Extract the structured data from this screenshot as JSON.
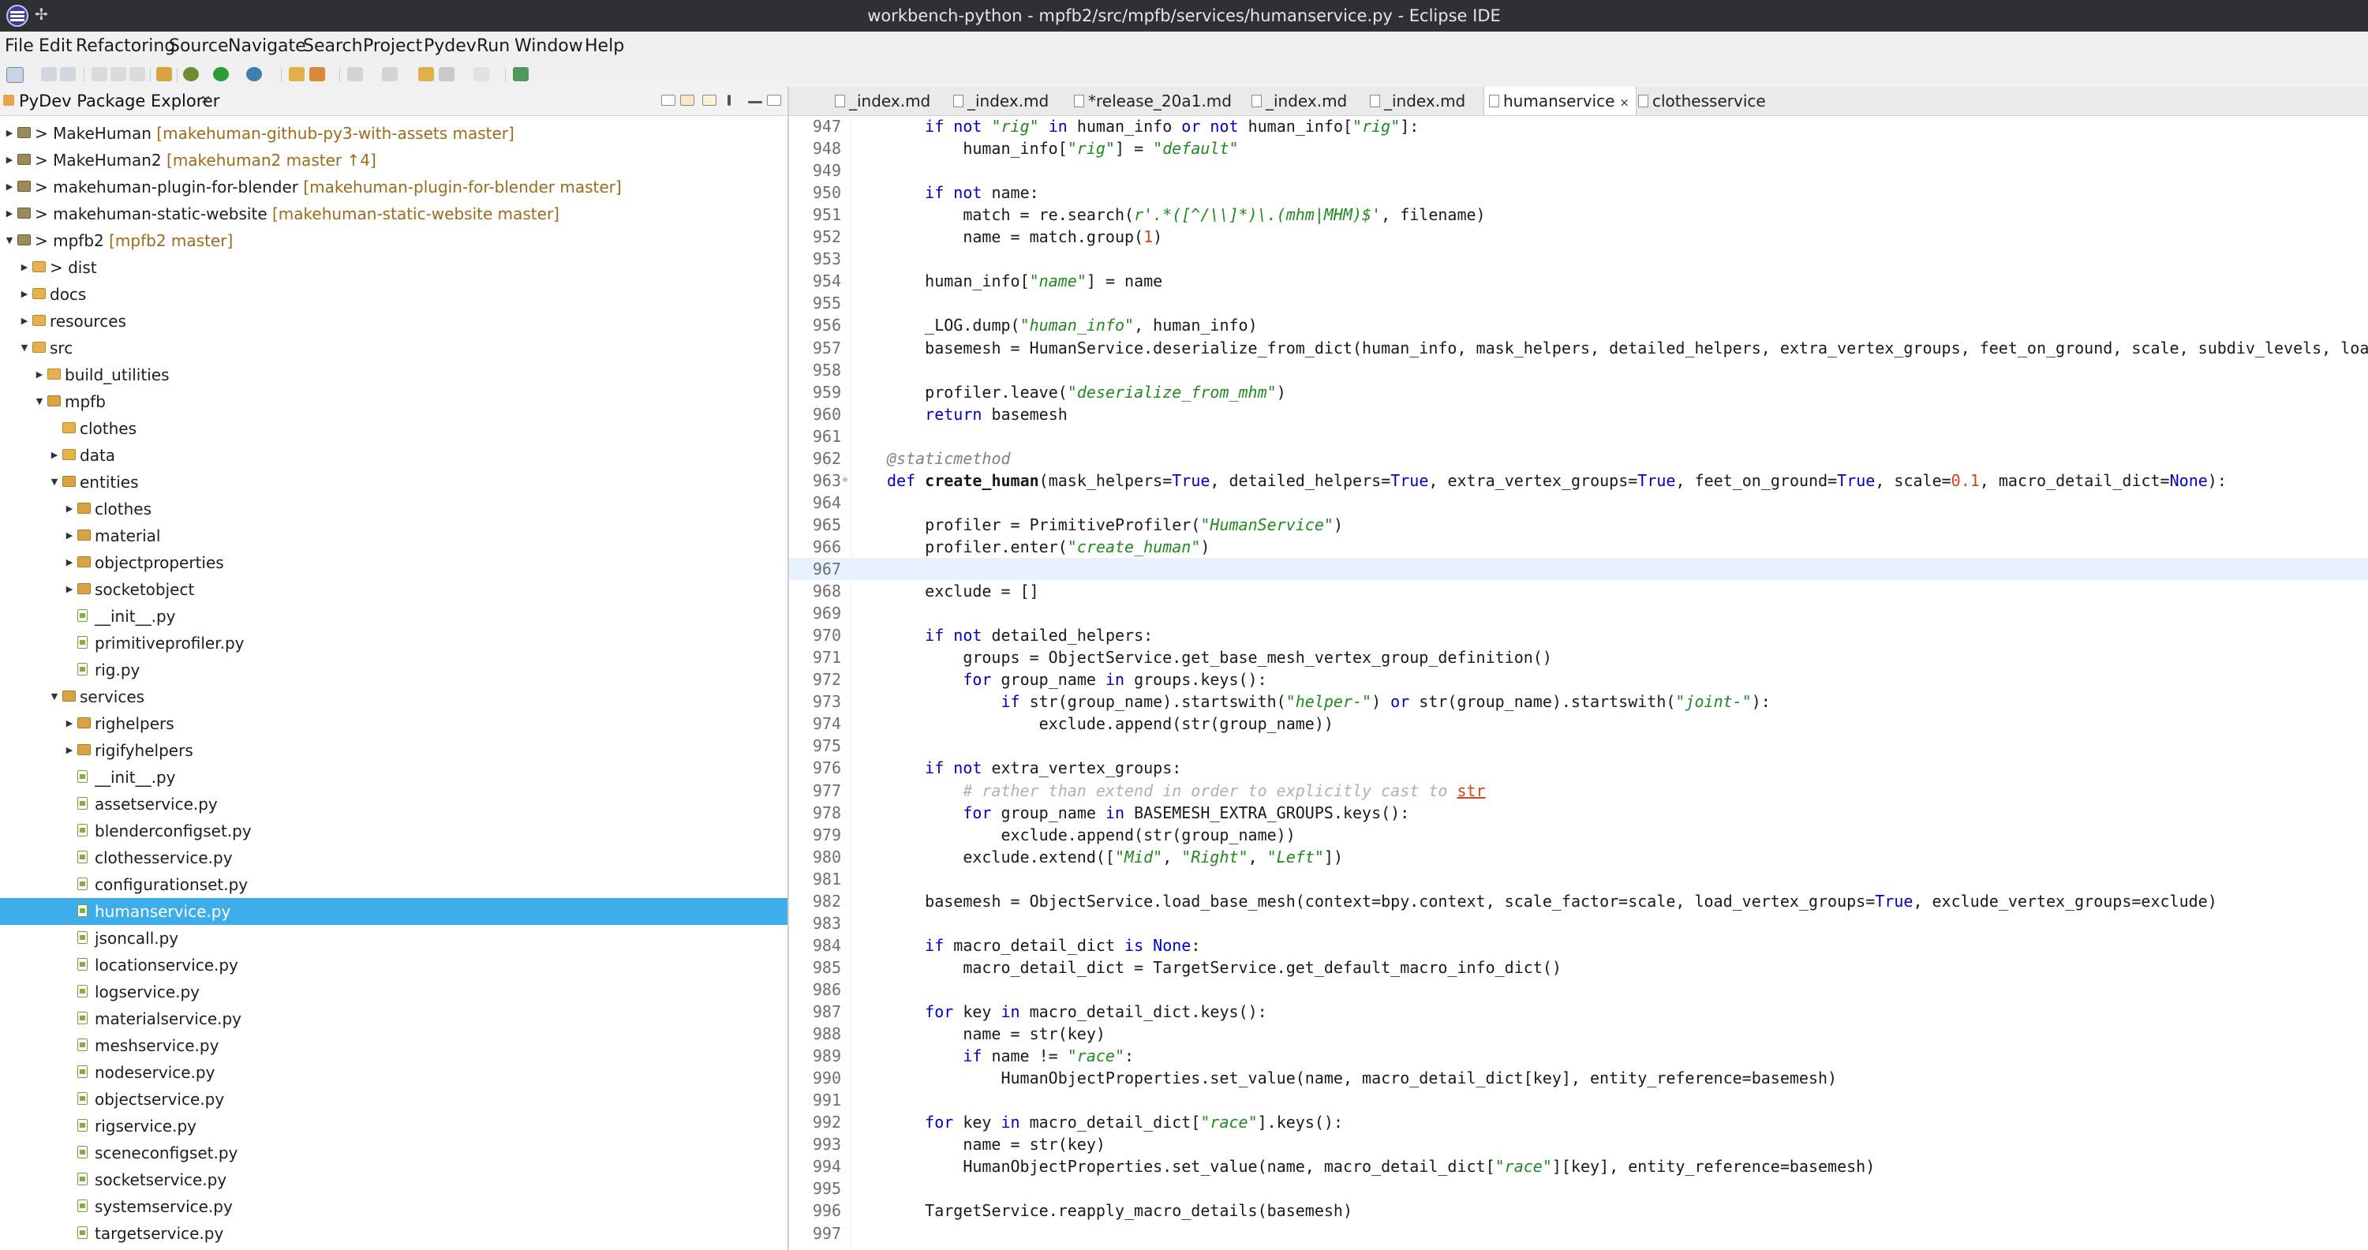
{
  "window": {
    "title": "workbench-python - mpfb2/src/mpfb/services/humanservice.py - Eclipse IDE"
  },
  "menu": [
    "File",
    "Edit",
    "Refactoring",
    "Source",
    "Navigate",
    "Search",
    "Project",
    "Pydev",
    "Run",
    "Window",
    "Help"
  ],
  "explorer": {
    "title": "PyDev Package Explorer",
    "close_symbol": "×",
    "rows": [
      {
        "label": "> MakeHuman",
        "git": "[makehuman-github-py3-with-assets master]",
        "depth": 0,
        "arrow": "right",
        "icon": "project"
      },
      {
        "label": "> MakeHuman2",
        "git": "[makehuman2 master ↑4]",
        "depth": 0,
        "arrow": "right",
        "icon": "project"
      },
      {
        "label": "> makehuman-plugin-for-blender",
        "git": "[makehuman-plugin-for-blender master]",
        "depth": 0,
        "arrow": "right",
        "icon": "project"
      },
      {
        "label": "> makehuman-static-website",
        "git": "[makehuman-static-website master]",
        "depth": 0,
        "arrow": "right",
        "icon": "project"
      },
      {
        "label": "> mpfb2",
        "git": "[mpfb2 master]",
        "depth": 0,
        "arrow": "down",
        "icon": "project"
      },
      {
        "label": "> dist",
        "git": "",
        "depth": 1,
        "arrow": "right",
        "icon": "folder"
      },
      {
        "label": "docs",
        "git": "",
        "depth": 1,
        "arrow": "right",
        "icon": "folder"
      },
      {
        "label": "resources",
        "git": "",
        "depth": 1,
        "arrow": "right",
        "icon": "folder"
      },
      {
        "label": "src",
        "git": "",
        "depth": 1,
        "arrow": "down",
        "icon": "folder"
      },
      {
        "label": "build_utilities",
        "git": "",
        "depth": 2,
        "arrow": "right",
        "icon": "folder"
      },
      {
        "label": "mpfb",
        "git": "",
        "depth": 2,
        "arrow": "down",
        "icon": "pkg"
      },
      {
        "label": "clothes",
        "git": "",
        "depth": 3,
        "arrow": "",
        "icon": "folder"
      },
      {
        "label": "data",
        "git": "",
        "depth": 3,
        "arrow": "right",
        "icon": "folder"
      },
      {
        "label": "entities",
        "git": "",
        "depth": 3,
        "arrow": "down",
        "icon": "pkg"
      },
      {
        "label": "clothes",
        "git": "",
        "depth": 4,
        "arrow": "right",
        "icon": "pkg"
      },
      {
        "label": "material",
        "git": "",
        "depth": 4,
        "arrow": "right",
        "icon": "pkg"
      },
      {
        "label": "objectproperties",
        "git": "",
        "depth": 4,
        "arrow": "right",
        "icon": "pkg"
      },
      {
        "label": "socketobject",
        "git": "",
        "depth": 4,
        "arrow": "right",
        "icon": "pkg"
      },
      {
        "label": "__init__.py",
        "git": "",
        "depth": 4,
        "arrow": "",
        "icon": "file"
      },
      {
        "label": "primitiveprofiler.py",
        "git": "",
        "depth": 4,
        "arrow": "",
        "icon": "file"
      },
      {
        "label": "rig.py",
        "git": "",
        "depth": 4,
        "arrow": "",
        "icon": "file"
      },
      {
        "label": "services",
        "git": "",
        "depth": 3,
        "arrow": "down",
        "icon": "pkg"
      },
      {
        "label": "righelpers",
        "git": "",
        "depth": 4,
        "arrow": "right",
        "icon": "pkg"
      },
      {
        "label": "rigifyhelpers",
        "git": "",
        "depth": 4,
        "arrow": "right",
        "icon": "pkg"
      },
      {
        "label": "__init__.py",
        "git": "",
        "depth": 4,
        "arrow": "",
        "icon": "file"
      },
      {
        "label": "assetservice.py",
        "git": "",
        "depth": 4,
        "arrow": "",
        "icon": "file"
      },
      {
        "label": "blenderconfigset.py",
        "git": "",
        "depth": 4,
        "arrow": "",
        "icon": "file"
      },
      {
        "label": "clothesservice.py",
        "git": "",
        "depth": 4,
        "arrow": "",
        "icon": "file"
      },
      {
        "label": "configurationset.py",
        "git": "",
        "depth": 4,
        "arrow": "",
        "icon": "file"
      },
      {
        "label": "humanservice.py",
        "git": "",
        "depth": 4,
        "arrow": "",
        "icon": "file",
        "selected": true
      },
      {
        "label": "jsoncall.py",
        "git": "",
        "depth": 4,
        "arrow": "",
        "icon": "file"
      },
      {
        "label": "locationservice.py",
        "git": "",
        "depth": 4,
        "arrow": "",
        "icon": "file"
      },
      {
        "label": "logservice.py",
        "git": "",
        "depth": 4,
        "arrow": "",
        "icon": "file"
      },
      {
        "label": "materialservice.py",
        "git": "",
        "depth": 4,
        "arrow": "",
        "icon": "file"
      },
      {
        "label": "meshservice.py",
        "git": "",
        "depth": 4,
        "arrow": "",
        "icon": "file"
      },
      {
        "label": "nodeservice.py",
        "git": "",
        "depth": 4,
        "arrow": "",
        "icon": "file"
      },
      {
        "label": "objectservice.py",
        "git": "",
        "depth": 4,
        "arrow": "",
        "icon": "file"
      },
      {
        "label": "rigservice.py",
        "git": "",
        "depth": 4,
        "arrow": "",
        "icon": "file"
      },
      {
        "label": "sceneconfigset.py",
        "git": "",
        "depth": 4,
        "arrow": "",
        "icon": "file"
      },
      {
        "label": "socketservice.py",
        "git": "",
        "depth": 4,
        "arrow": "",
        "icon": "file"
      },
      {
        "label": "systemservice.py",
        "git": "",
        "depth": 4,
        "arrow": "",
        "icon": "file"
      },
      {
        "label": "targetservice.py",
        "git": "",
        "depth": 4,
        "arrow": "",
        "icon": "file"
      }
    ]
  },
  "editor": {
    "tabs": [
      {
        "label": "_index.md",
        "active": false
      },
      {
        "label": "_index.md",
        "active": false
      },
      {
        "label": "*release_20a1.md",
        "active": false
      },
      {
        "label": "_index.md",
        "active": false
      },
      {
        "label": "_index.md",
        "active": false
      },
      {
        "label": "humanservice",
        "active": true,
        "close": "×"
      },
      {
        "label": "clothesservice",
        "active": false
      }
    ],
    "current_line": 967,
    "lines": [
      {
        "n": 947,
        "i": 2,
        "t": [
          [
            "kw",
            "if not "
          ],
          [
            "s",
            "\"rig\""
          ],
          [
            "kw",
            " in "
          ],
          [
            "",
            "human_info "
          ],
          [
            "kw",
            "or not "
          ],
          [
            "",
            "human_info["
          ],
          [
            "s",
            "\"rig\""
          ],
          [
            "",
            "]:"
          ]
        ]
      },
      {
        "n": 948,
        "i": 3,
        "t": [
          [
            "",
            "human_info["
          ],
          [
            "s",
            "\"rig\""
          ],
          [
            "",
            "] = "
          ],
          [
            "s",
            "\"default\""
          ]
        ]
      },
      {
        "n": 949,
        "i": 0,
        "t": []
      },
      {
        "n": 950,
        "i": 2,
        "t": [
          [
            "kw",
            "if not "
          ],
          [
            "",
            "name:"
          ]
        ]
      },
      {
        "n": 951,
        "i": 3,
        "t": [
          [
            "",
            "match = re.search("
          ],
          [
            "s",
            "r'.*([^/\\\\]*)\\.(mhm|MHM)$'"
          ],
          [
            "",
            ", filename)"
          ]
        ]
      },
      {
        "n": 952,
        "i": 3,
        "t": [
          [
            "",
            "name = match.group("
          ],
          [
            "num",
            "1"
          ],
          [
            "",
            ")"
          ]
        ]
      },
      {
        "n": 953,
        "i": 0,
        "t": []
      },
      {
        "n": 954,
        "i": 2,
        "t": [
          [
            "",
            "human_info["
          ],
          [
            "s",
            "\"name\""
          ],
          [
            "",
            "] = name"
          ]
        ]
      },
      {
        "n": 955,
        "i": 0,
        "t": []
      },
      {
        "n": 956,
        "i": 2,
        "t": [
          [
            "",
            "_LOG.dump("
          ],
          [
            "s",
            "\"human_info\""
          ],
          [
            "",
            ", human_info)"
          ]
        ]
      },
      {
        "n": 957,
        "i": 2,
        "t": [
          [
            "",
            "basemesh = HumanService.deserialize_from_dict(human_info, mask_helpers, detailed_helpers, extra_vertex_groups, feet_on_ground, scale, subdiv_levels, load"
          ]
        ]
      },
      {
        "n": 958,
        "i": 0,
        "t": []
      },
      {
        "n": 959,
        "i": 2,
        "t": [
          [
            "",
            "profiler.leave("
          ],
          [
            "s",
            "\"deserialize_from_mhm\""
          ],
          [
            "",
            ")"
          ]
        ]
      },
      {
        "n": 960,
        "i": 2,
        "t": [
          [
            "kw",
            "return "
          ],
          [
            "",
            "basemesh"
          ]
        ]
      },
      {
        "n": 961,
        "i": 0,
        "t": []
      },
      {
        "n": 962,
        "i": 1,
        "t": [
          [
            "dec",
            "@staticmethod"
          ]
        ]
      },
      {
        "n": 963,
        "i": 1,
        "fold": true,
        "t": [
          [
            "kw",
            "def "
          ],
          [
            "fn",
            "create_human"
          ],
          [
            "",
            "(mask_helpers="
          ],
          [
            "kw",
            "True"
          ],
          [
            "",
            ", detailed_helpers="
          ],
          [
            "kw",
            "True"
          ],
          [
            "",
            ", extra_vertex_groups="
          ],
          [
            "kw",
            "True"
          ],
          [
            "",
            ", feet_on_ground="
          ],
          [
            "kw",
            "True"
          ],
          [
            "",
            ", scale="
          ],
          [
            "num",
            "0.1"
          ],
          [
            "",
            ", macro_detail_dict="
          ],
          [
            "kw",
            "None"
          ],
          [
            "",
            "):"
          ]
        ]
      },
      {
        "n": 964,
        "i": 0,
        "t": []
      },
      {
        "n": 965,
        "i": 2,
        "t": [
          [
            "",
            "profiler = PrimitiveProfiler("
          ],
          [
            "s",
            "\"HumanService\""
          ],
          [
            "",
            ")"
          ]
        ]
      },
      {
        "n": 966,
        "i": 2,
        "t": [
          [
            "",
            "profiler.enter("
          ],
          [
            "s",
            "\"create_human\""
          ],
          [
            "",
            ")"
          ]
        ]
      },
      {
        "n": 967,
        "i": 0,
        "t": []
      },
      {
        "n": 968,
        "i": 2,
        "t": [
          [
            "",
            "exclude = []"
          ]
        ]
      },
      {
        "n": 969,
        "i": 0,
        "t": []
      },
      {
        "n": 970,
        "i": 2,
        "t": [
          [
            "kw",
            "if not "
          ],
          [
            "",
            "detailed_helpers:"
          ]
        ]
      },
      {
        "n": 971,
        "i": 3,
        "t": [
          [
            "",
            "groups = ObjectService.get_base_mesh_vertex_group_definition()"
          ]
        ]
      },
      {
        "n": 972,
        "i": 3,
        "t": [
          [
            "kw",
            "for "
          ],
          [
            "",
            "group_name "
          ],
          [
            "kw",
            "in "
          ],
          [
            "",
            "groups.keys():"
          ]
        ]
      },
      {
        "n": 973,
        "i": 4,
        "t": [
          [
            "kw",
            "if "
          ],
          [
            "",
            "str(group_name).startswith("
          ],
          [
            "s",
            "\"helper-\""
          ],
          [
            "",
            ") "
          ],
          [
            "kw",
            "or "
          ],
          [
            "",
            "str(group_name).startswith("
          ],
          [
            "s",
            "\"joint-\""
          ],
          [
            "",
            "):"
          ]
        ]
      },
      {
        "n": 974,
        "i": 5,
        "t": [
          [
            "",
            "exclude.append(str(group_name))"
          ]
        ]
      },
      {
        "n": 975,
        "i": 0,
        "t": []
      },
      {
        "n": 976,
        "i": 2,
        "t": [
          [
            "kw",
            "if not "
          ],
          [
            "",
            "extra_vertex_groups:"
          ]
        ]
      },
      {
        "n": 977,
        "i": 3,
        "t": [
          [
            "cm",
            "# rather than extend in order to explicitly cast to "
          ],
          [
            "sq",
            "str"
          ]
        ]
      },
      {
        "n": 978,
        "i": 3,
        "t": [
          [
            "kw",
            "for "
          ],
          [
            "",
            "group_name "
          ],
          [
            "kw",
            "in "
          ],
          [
            "",
            "BASEMESH_EXTRA_GROUPS.keys():"
          ]
        ]
      },
      {
        "n": 979,
        "i": 4,
        "t": [
          [
            "",
            "exclude.append(str(group_name))"
          ]
        ]
      },
      {
        "n": 980,
        "i": 3,
        "t": [
          [
            "",
            "exclude.extend(["
          ],
          [
            "s",
            "\"Mid\""
          ],
          [
            "",
            ", "
          ],
          [
            "s",
            "\"Right\""
          ],
          [
            "",
            ", "
          ],
          [
            "s",
            "\"Left\""
          ],
          [
            "",
            "])"
          ]
        ]
      },
      {
        "n": 981,
        "i": 0,
        "t": []
      },
      {
        "n": 982,
        "i": 2,
        "t": [
          [
            "",
            "basemesh = ObjectService.load_base_mesh(context=bpy.context, scale_factor=scale, load_vertex_groups="
          ],
          [
            "kw",
            "True"
          ],
          [
            "",
            ", exclude_vertex_groups=exclude)"
          ]
        ]
      },
      {
        "n": 983,
        "i": 0,
        "t": []
      },
      {
        "n": 984,
        "i": 2,
        "t": [
          [
            "kw",
            "if "
          ],
          [
            "",
            "macro_detail_dict "
          ],
          [
            "kw",
            "is None"
          ],
          [
            "",
            ":"
          ]
        ]
      },
      {
        "n": 985,
        "i": 3,
        "t": [
          [
            "",
            "macro_detail_dict = TargetService.get_default_macro_info_dict()"
          ]
        ]
      },
      {
        "n": 986,
        "i": 0,
        "t": []
      },
      {
        "n": 987,
        "i": 2,
        "t": [
          [
            "kw",
            "for "
          ],
          [
            "",
            "key "
          ],
          [
            "kw",
            "in "
          ],
          [
            "",
            "macro_detail_dict.keys():"
          ]
        ]
      },
      {
        "n": 988,
        "i": 3,
        "t": [
          [
            "",
            "name = str(key)"
          ]
        ]
      },
      {
        "n": 989,
        "i": 3,
        "t": [
          [
            "kw",
            "if "
          ],
          [
            "",
            "name != "
          ],
          [
            "s",
            "\"race\""
          ],
          [
            "",
            ":"
          ]
        ]
      },
      {
        "n": 990,
        "i": 4,
        "t": [
          [
            "",
            "HumanObjectProperties.set_value(name, macro_detail_dict[key], entity_reference=basemesh)"
          ]
        ]
      },
      {
        "n": 991,
        "i": 0,
        "t": []
      },
      {
        "n": 992,
        "i": 2,
        "t": [
          [
            "kw",
            "for "
          ],
          [
            "",
            "key "
          ],
          [
            "kw",
            "in "
          ],
          [
            "",
            "macro_detail_dict["
          ],
          [
            "s",
            "\"race\""
          ],
          [
            "",
            "].keys():"
          ]
        ]
      },
      {
        "n": 993,
        "i": 3,
        "t": [
          [
            "",
            "name = str(key)"
          ]
        ]
      },
      {
        "n": 994,
        "i": 3,
        "t": [
          [
            "",
            "HumanObjectProperties.set_value(name, macro_detail_dict["
          ],
          [
            "s",
            "\"race\""
          ],
          [
            "",
            "][key], entity_reference=basemesh)"
          ]
        ]
      },
      {
        "n": 995,
        "i": 0,
        "t": []
      },
      {
        "n": 996,
        "i": 2,
        "t": [
          [
            "",
            "TargetService.reapply_macro_details(basemesh)"
          ]
        ]
      },
      {
        "n": 997,
        "i": 0,
        "t": []
      }
    ]
  }
}
